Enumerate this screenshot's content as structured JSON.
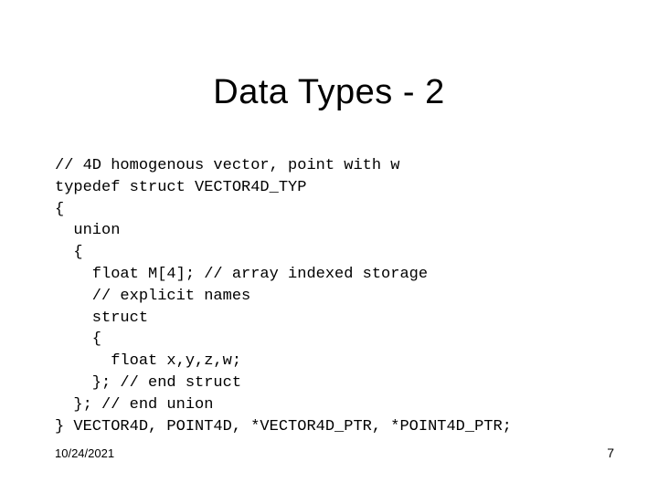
{
  "title": "Data Types - 2",
  "code": {
    "l1": "// 4D homogenous vector, point with w",
    "l2": "typedef struct VECTOR4D_TYP",
    "l3": "{",
    "l4": "  union",
    "l5": "  {",
    "l6": "    float M[4]; // array indexed storage",
    "l7": "    // explicit names",
    "l8": "    struct",
    "l9": "    {",
    "l10": "      float x,y,z,w;",
    "l11": "    }; // end struct",
    "l12": "  }; // end union",
    "l13": "} VECTOR4D, POINT4D, *VECTOR4D_PTR, *POINT4D_PTR;"
  },
  "footer": {
    "date": "10/24/2021",
    "page": "7"
  }
}
